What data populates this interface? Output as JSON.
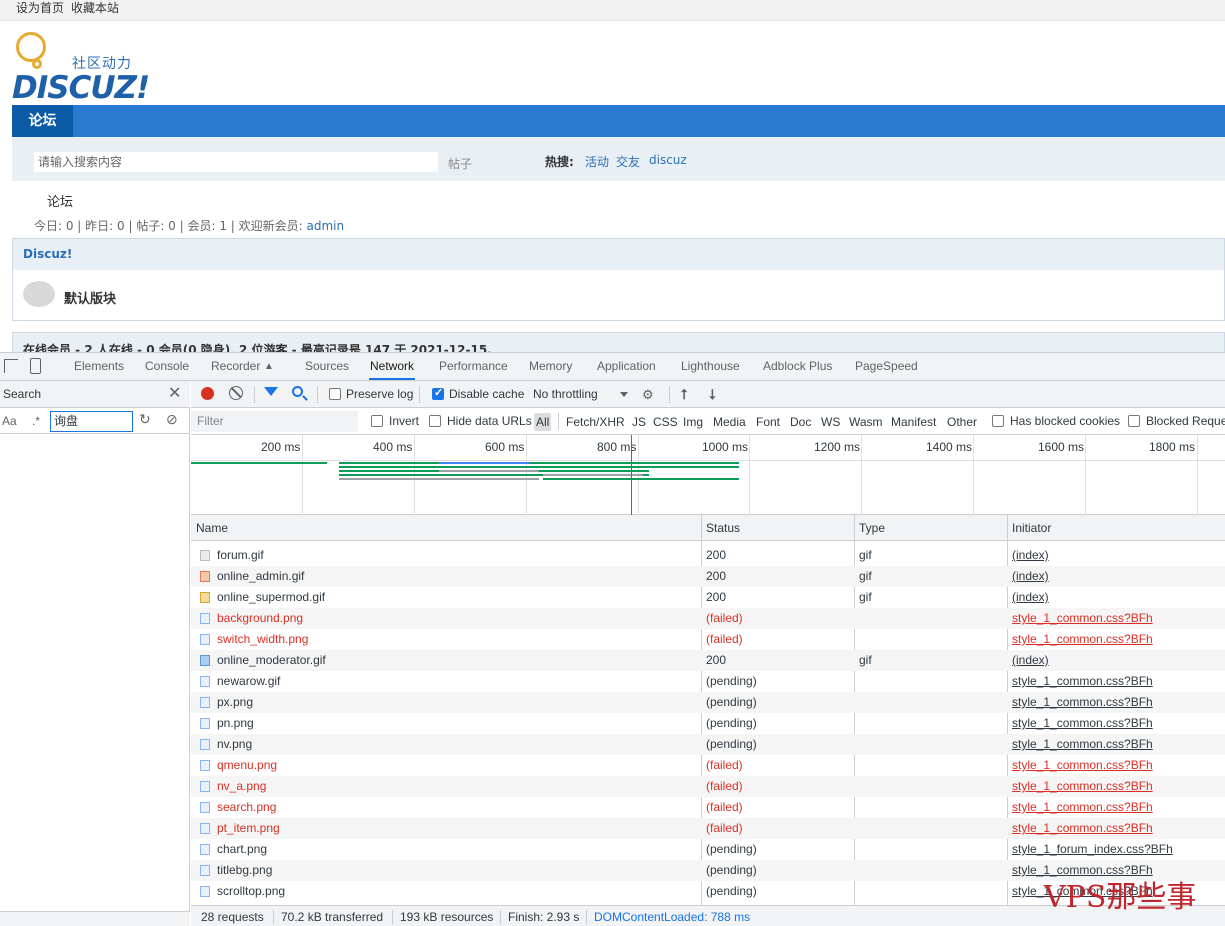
{
  "forum": {
    "topbar": {
      "set_home": "设为首页",
      "bookmark": "收藏本站"
    },
    "logo": {
      "cn": "社区动力",
      "en": "DISCUZ!"
    },
    "nav": {
      "active": "论坛"
    },
    "search": {
      "placeholder": "请输入搜索内容",
      "type": "帖子",
      "hot_label": "热搜:",
      "hot_links": [
        "活动",
        "交友",
        "discuz"
      ]
    },
    "breadcrumb": "论坛",
    "stats": {
      "text": "今日: 0 | 昨日: 0 | 帖子: 0 | 会员: 1 | 欢迎新会员: ",
      "user": "admin"
    },
    "section": {
      "title": "Discuz!",
      "forum_name": "默认版块"
    },
    "online": "在线会员 - 2 人在线 - 0 会员(0 隐身), 2 位游客 - 最高记录是 147 于 2021-12-15."
  },
  "devtools": {
    "tabs": [
      "Elements",
      "Console",
      "Recorder",
      "Sources",
      "Network",
      "Performance",
      "Memory",
      "Application",
      "Lighthouse",
      "Adblock Plus",
      "PageSpeed"
    ],
    "active_tab": "Network",
    "search_pane": {
      "title": "Search",
      "aa": "Aa",
      "regex": ".*",
      "query": "询盘"
    },
    "toolbar": {
      "preserve_log": "Preserve log",
      "disable_cache": "Disable cache",
      "throttling": "No throttling"
    },
    "filter": {
      "placeholder": "Filter",
      "invert": "Invert",
      "hide_data_urls": "Hide data URLs",
      "types": [
        "All",
        "Fetch/XHR",
        "JS",
        "CSS",
        "Img",
        "Media",
        "Font",
        "Doc",
        "WS",
        "Wasm",
        "Manifest",
        "Other"
      ],
      "has_blocked_cookies": "Has blocked cookies",
      "blocked_requests": "Blocked Reque"
    },
    "overview_ticks": [
      "200 ms",
      "400 ms",
      "600 ms",
      "800 ms",
      "1000 ms",
      "1200 ms",
      "1400 ms",
      "1600 ms",
      "1800 ms"
    ],
    "columns": {
      "name": "Name",
      "status": "Status",
      "type": "Type",
      "initiator": "Initiator"
    },
    "rows": [
      {
        "name": "forum.gif",
        "status": "200",
        "type": "gif",
        "initiator": "(index)",
        "icon": "gif",
        "failed": false
      },
      {
        "name": "online_admin.gif",
        "status": "200",
        "type": "gif",
        "initiator": "(index)",
        "icon": "img-r",
        "failed": false
      },
      {
        "name": "online_supermod.gif",
        "status": "200",
        "type": "gif",
        "initiator": "(index)",
        "icon": "img-y",
        "failed": false
      },
      {
        "name": "background.png",
        "status": "(failed)",
        "type": "",
        "initiator": "style_1_common.css?BFh",
        "icon": "doc",
        "failed": true
      },
      {
        "name": "switch_width.png",
        "status": "(failed)",
        "type": "",
        "initiator": "style_1_common.css?BFh",
        "icon": "doc",
        "failed": true
      },
      {
        "name": "online_moderator.gif",
        "status": "200",
        "type": "gif",
        "initiator": "(index)",
        "icon": "img-b",
        "failed": false
      },
      {
        "name": "newarow.gif",
        "status": "(pending)",
        "type": "",
        "initiator": "style_1_common.css?BFh",
        "icon": "doc",
        "failed": false
      },
      {
        "name": "px.png",
        "status": "(pending)",
        "type": "",
        "initiator": "style_1_common.css?BFh",
        "icon": "doc",
        "failed": false
      },
      {
        "name": "pn.png",
        "status": "(pending)",
        "type": "",
        "initiator": "style_1_common.css?BFh",
        "icon": "doc",
        "failed": false
      },
      {
        "name": "nv.png",
        "status": "(pending)",
        "type": "",
        "initiator": "style_1_common.css?BFh",
        "icon": "doc",
        "failed": false
      },
      {
        "name": "qmenu.png",
        "status": "(failed)",
        "type": "",
        "initiator": "style_1_common.css?BFh",
        "icon": "doc",
        "failed": true
      },
      {
        "name": "nv_a.png",
        "status": "(failed)",
        "type": "",
        "initiator": "style_1_common.css?BFh",
        "icon": "doc",
        "failed": true
      },
      {
        "name": "search.png",
        "status": "(failed)",
        "type": "",
        "initiator": "style_1_common.css?BFh",
        "icon": "doc",
        "failed": true
      },
      {
        "name": "pt_item.png",
        "status": "(failed)",
        "type": "",
        "initiator": "style_1_common.css?BFh",
        "icon": "doc",
        "failed": true
      },
      {
        "name": "chart.png",
        "status": "(pending)",
        "type": "",
        "initiator": "style_1_forum_index.css?BFh",
        "icon": "doc",
        "failed": false
      },
      {
        "name": "titlebg.png",
        "status": "(pending)",
        "type": "",
        "initiator": "style_1_common.css?BFh",
        "icon": "doc",
        "failed": false
      },
      {
        "name": "scrolltop.png",
        "status": "(pending)",
        "type": "",
        "initiator": "style_1_common.css?BFh",
        "icon": "doc",
        "failed": false
      }
    ],
    "status_bar": {
      "requests": "28 requests",
      "transferred": "70.2 kB transferred",
      "resources": "193 kB resources",
      "finish": "Finish: 2.93 s",
      "dom": "DOMContentLoaded: 788 ms"
    }
  },
  "watermark": "VPS那些事",
  "colors": {
    "nav_blue": "#2b7ad1",
    "failed_red": "#d93025",
    "devtools_blue": "#1a73e8"
  }
}
